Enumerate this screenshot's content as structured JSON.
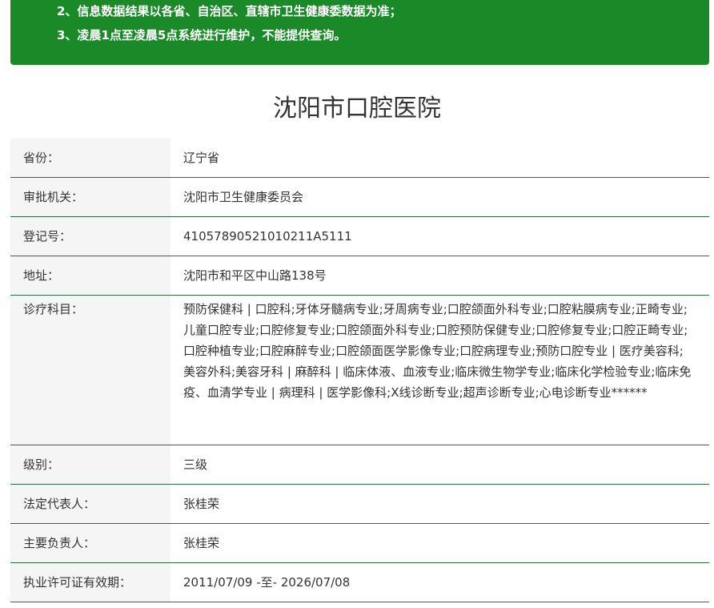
{
  "notice": {
    "line2": "2、信息数据结果以各省、自治区、直辖市卫生健康委数据为准；",
    "line3": "3、凌晨1点至凌晨5点系统进行维护，不能提供查询。"
  },
  "hospital": {
    "name": "沈阳市口腔医院"
  },
  "fields": [
    {
      "label": "省份：",
      "value": "辽宁省"
    },
    {
      "label": "审批机关：",
      "value": "沈阳市卫生健康委员会"
    },
    {
      "label": "登记号：",
      "value": "41057890521010211A5111"
    },
    {
      "label": "地址：",
      "value": "沈阳市和平区中山路138号"
    },
    {
      "label": "诊疗科目：",
      "value": "预防保健科 | 口腔科;牙体牙髓病专业;牙周病专业;口腔颌面外科专业;口腔粘膜病专业;正畸专业;儿童口腔专业;口腔修复专业;口腔颌面外科专业;口腔预防保健专业;口腔修复专业;口腔正畸专业;口腔种植专业;口腔麻醉专业;口腔颌面医学影像专业;口腔病理专业;预防口腔专业 | 医疗美容科;美容外科;美容牙科 | 麻醉科 | 临床体液、血液专业;临床微生物学专业;临床化学检验专业;临床免疫、血清学专业 | 病理科 | 医学影像科;X线诊断专业;超声诊断专业;心电诊断专业******"
    },
    {
      "label": "级别：",
      "value": "三级"
    },
    {
      "label": "法定代表人：",
      "value": "张桂荣"
    },
    {
      "label": "主要负责人：",
      "value": "张桂荣"
    },
    {
      "label": "执业许可证有效期：",
      "value": "2011/07/09 -至- 2026/07/08"
    }
  ],
  "colors": {
    "notice_bg": "#1a8a28",
    "row_divider": "#2c6b3a",
    "label_bg": "#f5f5f5"
  }
}
